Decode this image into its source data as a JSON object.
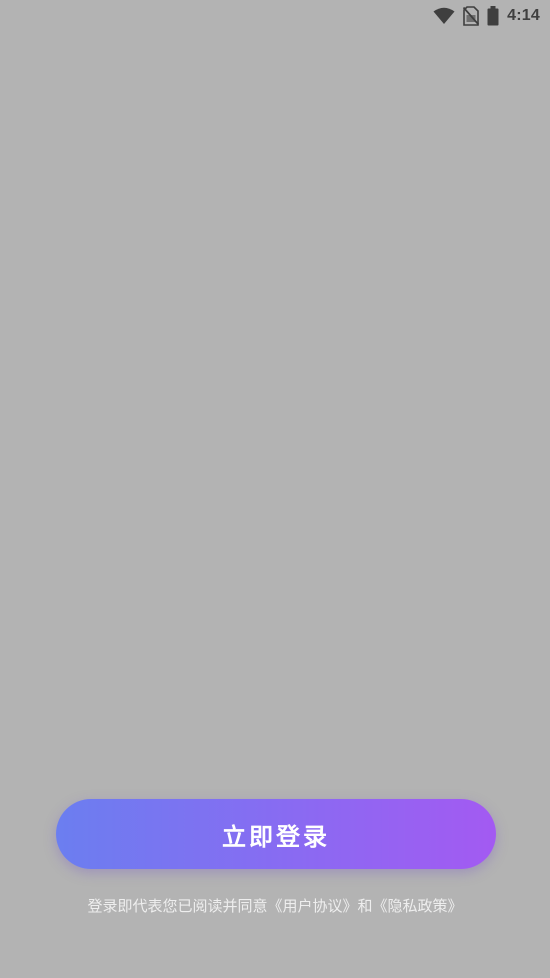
{
  "status_bar": {
    "time": "4:14",
    "icons": [
      "wifi-icon",
      "no-sim-icon",
      "battery-icon"
    ]
  },
  "login": {
    "button_label": "立即登录"
  },
  "agreement": {
    "prefix": "登录即代表您已阅读并同意",
    "user_agreement": "《用户协议》",
    "conjunction": "和",
    "privacy_policy": "《隐私政策》"
  },
  "colors": {
    "background": "#b3b3b3",
    "button_gradient_start": "#6b7ef0",
    "button_gradient_end": "#a35af2",
    "status_icon": "#3f3f3f"
  }
}
